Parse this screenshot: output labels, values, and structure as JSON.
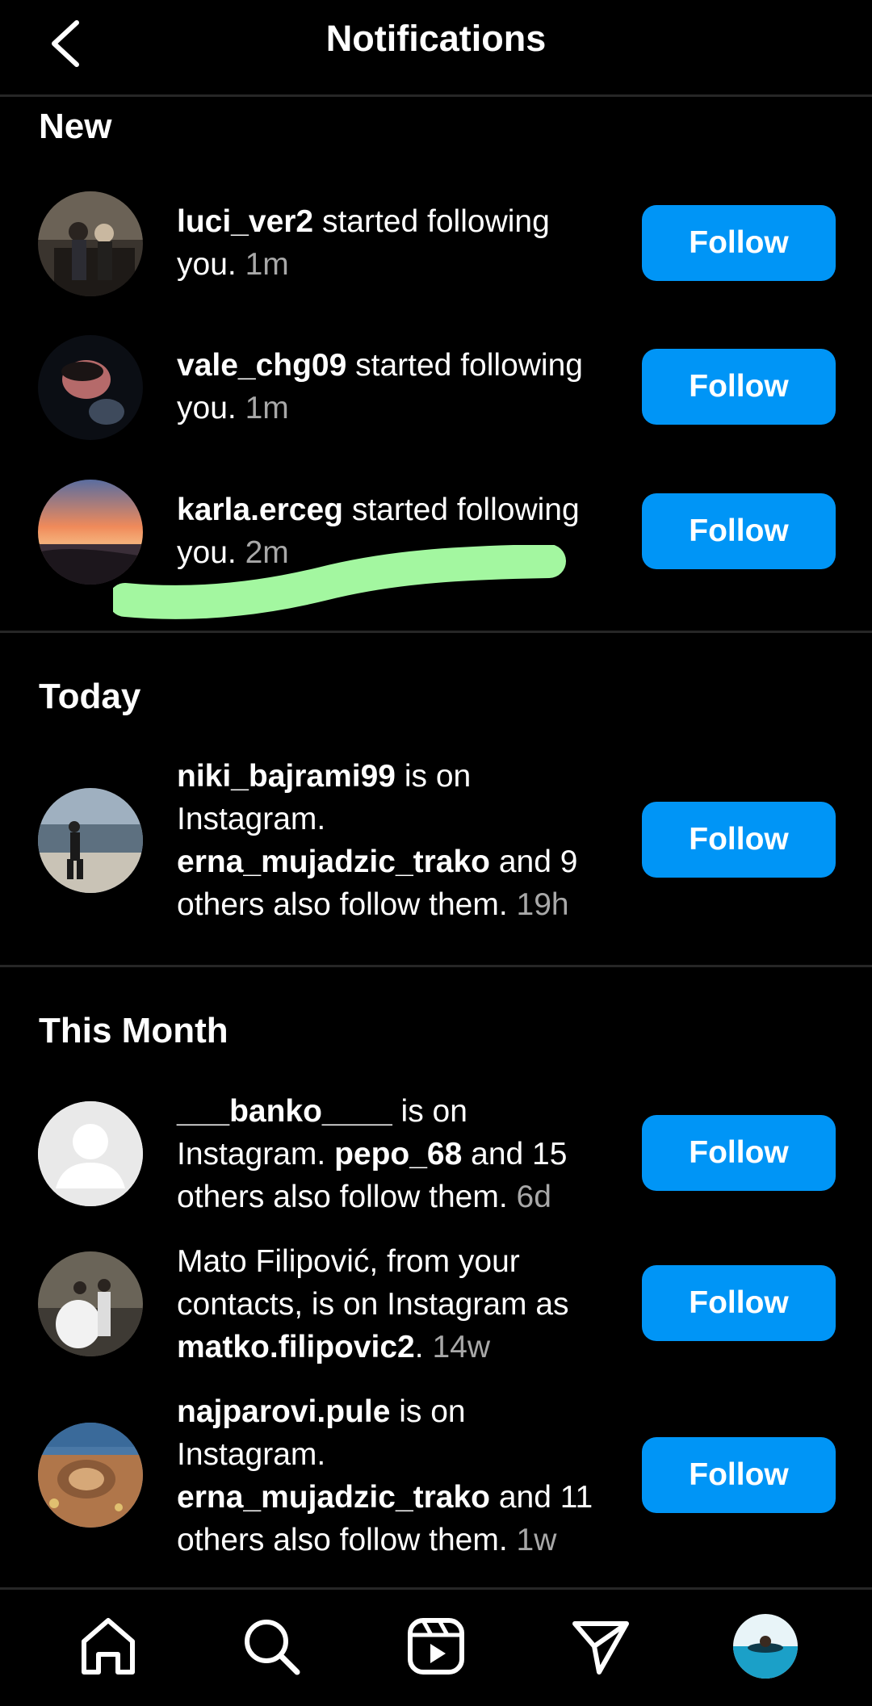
{
  "header": {
    "title": "Notifications",
    "back_icon": "chevron-left-icon"
  },
  "sections": [
    {
      "title": "New"
    },
    {
      "title": "Today"
    },
    {
      "title": "This Month"
    }
  ],
  "notifications": [
    {
      "username": "luci_ver2",
      "text": " started following you.",
      "time": "1m",
      "button": "Follow"
    },
    {
      "username": "vale_chg09",
      "text": " started following you.",
      "time": "1m",
      "button": "Follow"
    },
    {
      "username": "karla.erceg",
      "text": " started following you.",
      "time": "2m",
      "button": "Follow"
    },
    {
      "username": "niki_bajrami99",
      "text": " is on Instagram. ",
      "mutual": "erna_mujadzic_trako",
      "text2": " and 9 others also follow them.",
      "time": "19h",
      "button": "Follow"
    },
    {
      "username": "___banko____",
      "text": " is on Instagram. ",
      "mutual": "pepo_68",
      "text2": " and 15 others also follow them.",
      "time": "6d",
      "button": "Follow"
    },
    {
      "prefix": "Mato Filipović, from your contacts, is on Instagram as ",
      "username": "matko.filipovic2",
      "text": ".",
      "time": "14w",
      "button": "Follow"
    },
    {
      "username": "najparovi.pule",
      "text": " is on Instagram. ",
      "mutual": "erna_mujadzic_trako",
      "text2": " and 11 others also follow them.",
      "time": "1w",
      "button": "Follow"
    }
  ],
  "bottom_nav": [
    {
      "icon": "home-icon"
    },
    {
      "icon": "search-icon"
    },
    {
      "icon": "reels-icon"
    },
    {
      "icon": "send-icon"
    },
    {
      "icon": "profile-avatar"
    }
  ],
  "colors": {
    "accent": "#0095f6",
    "background": "#000000",
    "highlight": "#a3f7a0",
    "secondary_text": "#a8a8a8"
  }
}
